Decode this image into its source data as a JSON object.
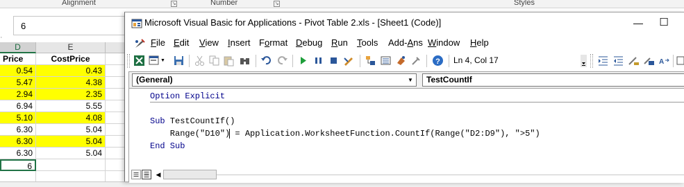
{
  "excel": {
    "ribbon_groups": [
      {
        "label": "Alignment"
      },
      {
        "label": "Number"
      },
      {
        "label": "Styles"
      }
    ],
    "formula_value": "6",
    "columns": [
      {
        "letter": "D"
      },
      {
        "letter": "E"
      }
    ],
    "headers": [
      "Price",
      "CostPrice"
    ],
    "rows": [
      {
        "price": "0.54",
        "cost": "0.43",
        "highlight": true
      },
      {
        "price": "5.47",
        "cost": "4.38",
        "highlight": true
      },
      {
        "price": "2.94",
        "cost": "2.35",
        "highlight": true
      },
      {
        "price": "6.94",
        "cost": "5.55",
        "highlight": false
      },
      {
        "price": "5.10",
        "cost": "4.08",
        "highlight": true
      },
      {
        "price": "6.30",
        "cost": "5.04",
        "highlight": false
      },
      {
        "price": "6.30",
        "cost": "5.04",
        "highlight": true
      },
      {
        "price": "6.30",
        "cost": "5.04",
        "highlight": false
      }
    ],
    "result_value": "6",
    "highlight_color": "#ffff00",
    "accent_color": "#217346"
  },
  "vbe": {
    "title": "Microsoft Visual Basic for Applications - Pivot Table 2.xls - [Sheet1 (Code)]",
    "window_buttons": {
      "minimize": "—",
      "restore": "☐"
    },
    "menu": [
      {
        "key": "F",
        "rest": "ile"
      },
      {
        "key": "E",
        "rest": "dit"
      },
      {
        "key": "V",
        "rest": "iew"
      },
      {
        "key": "I",
        "rest": "nsert"
      },
      {
        "key": "o",
        "pre": "F",
        "rest": "rmat"
      },
      {
        "key": "D",
        "rest": "ebug"
      },
      {
        "key": "R",
        "rest": "un"
      },
      {
        "key": "T",
        "rest": "ools"
      },
      {
        "key": "A",
        "pre": "Add-",
        "rest": "ns"
      },
      {
        "key": "W",
        "rest": "indow"
      },
      {
        "key": "H",
        "rest": "elp"
      }
    ],
    "cursor_position": "Ln 4, Col 17",
    "object_combo": "(General)",
    "procedure_combo": "TestCountIf",
    "code": {
      "line1_kw": "Option Explicit",
      "line2_kw": "Sub",
      "line2_rest": " TestCountIf()",
      "line3_a": "    Range(\"D10\")",
      "line3_b": " = Application.WorksheetFunction.CountIf(Range(\"D2:D9\"), \">5\")",
      "line4_kw": "End Sub"
    },
    "keyword_color": "#00008b"
  }
}
